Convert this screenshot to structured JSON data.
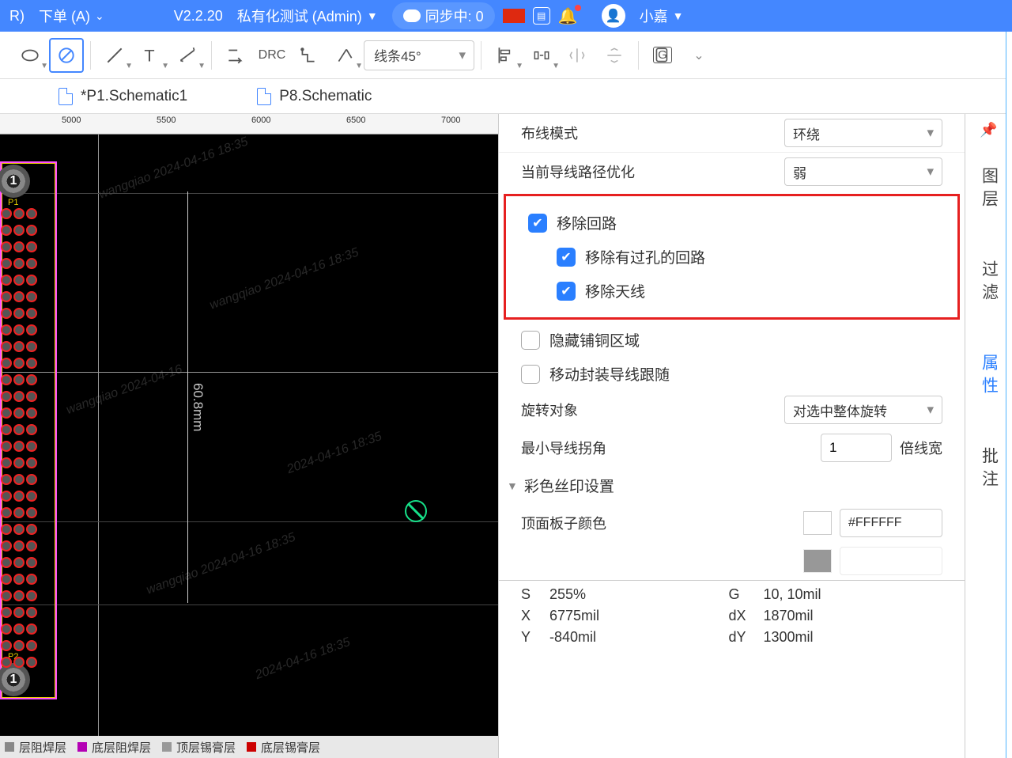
{
  "top": {
    "order_suffix": "R)",
    "order": "下单 (A)",
    "version": "V2.2.20",
    "env": "私有化测试 (Admin)",
    "sync": "同步中: 0",
    "user": "小嘉"
  },
  "toolbar": {
    "lineCombo": "线条45°",
    "grp": "G"
  },
  "tabs": {
    "t1": "*P1.Schematic1",
    "t2": "P8.Schematic"
  },
  "ruler": {
    "r1": "5000",
    "r2": "5500",
    "r3": "6000",
    "r4": "6500",
    "r5": "7000"
  },
  "canvas": {
    "dim": "60.8mm",
    "ref1": "P1",
    "ref2": "P2",
    "hole": "1"
  },
  "layers": {
    "l1": "层阻焊层",
    "l2": "底层阻焊层",
    "l3": "顶层锡膏层",
    "l4": "底层锡膏层"
  },
  "props": {
    "routeMode": "布线模式",
    "routeModeVal": "环绕",
    "optimize": "当前导线路径优化",
    "optimizeVal": "弱",
    "rmLoop": "移除回路",
    "rmVia": "移除有过孔的回路",
    "rmAnt": "移除天线",
    "hideCu": "隐藏铺铜区域",
    "followTrk": "移动封装导线跟随",
    "rotObj": "旋转对象",
    "rotObjVal": "对选中整体旋转",
    "minCorner": "最小导线拐角",
    "minCornerVal": "1",
    "minCornerUnit": "倍线宽",
    "silkSection": "彩色丝印设置",
    "topColor": "顶面板子颜色",
    "topColorVal": "#FFFFFF"
  },
  "coords": {
    "s": "S",
    "sVal": "255%",
    "g": "G",
    "gVal": "10, 10mil",
    "x": "X",
    "xVal": "6775mil",
    "dx": "dX",
    "dxVal": "1870mil",
    "y": "Y",
    "yVal": "-840mil",
    "dy": "dY",
    "dyVal": "1300mil"
  },
  "side": {
    "layers": "图层",
    "filter": "过滤",
    "attr": "属性",
    "note": "批注"
  }
}
